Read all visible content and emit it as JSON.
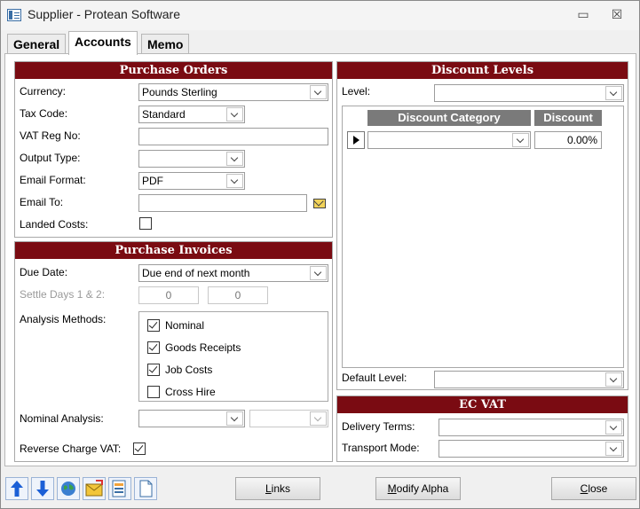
{
  "window": {
    "title": "Supplier - Protean Software",
    "minimize": "▭",
    "close": "☒"
  },
  "tabs": [
    {
      "label": "General",
      "active": false
    },
    {
      "label": "Accounts",
      "active": true
    },
    {
      "label": "Memo",
      "active": false
    }
  ],
  "purchase_orders": {
    "header": "Purchase Orders",
    "currency_label": "Currency:",
    "currency_value": "Pounds Sterling",
    "tax_code_label": "Tax Code:",
    "tax_code_value": "Standard",
    "vat_reg_label": "VAT Reg No:",
    "vat_reg_value": "",
    "output_type_label": "Output Type:",
    "output_type_value": "",
    "email_format_label": "Email Format:",
    "email_format_value": "PDF",
    "email_to_label": "Email To:",
    "email_to_value": "",
    "landed_costs_label": "Landed Costs:",
    "landed_costs_checked": false
  },
  "purchase_invoices": {
    "header": "Purchase Invoices",
    "due_date_label": "Due Date:",
    "due_date_value": "Due end of next month",
    "settle_days_label": "Settle Days 1 & 2:",
    "settle_day_1": "0",
    "settle_day_2": "0",
    "analysis_methods_label": "Analysis Methods:",
    "analysis_methods": [
      {
        "label": "Nominal",
        "checked": true
      },
      {
        "label": "Goods Receipts",
        "checked": true
      },
      {
        "label": "Job Costs",
        "checked": true
      },
      {
        "label": "Cross Hire",
        "checked": false
      }
    ],
    "nominal_analysis_label": "Nominal Analysis:",
    "nominal_analysis_value_1": "",
    "nominal_analysis_value_2": "",
    "reverse_charge_label": "Reverse Charge VAT:",
    "reverse_charge_checked": true
  },
  "discount_levels": {
    "header": "Discount Levels",
    "level_label": "Level:",
    "level_value": "",
    "columns": [
      "Discount Category",
      "Discount"
    ],
    "rows": [
      {
        "category": "",
        "discount": "0.00%"
      }
    ],
    "default_level_label": "Default Level:",
    "default_level_value": ""
  },
  "ec_vat": {
    "header": "EC VAT",
    "delivery_terms_label": "Delivery Terms:",
    "delivery_terms_value": "",
    "transport_mode_label": "Transport Mode:",
    "transport_mode_value": ""
  },
  "toolbar": {
    "icons": [
      "arrow-up-icon",
      "arrow-down-icon",
      "globe-icon",
      "email-icon",
      "document-list-icon",
      "blank-document-icon"
    ],
    "links_prefix": "L",
    "links_rest": "inks",
    "modify_prefix": "M",
    "modify_rest": "odify Alpha",
    "close_prefix": "C",
    "close_rest": "lose"
  },
  "colors": {
    "panel_header": "#7a0b12",
    "grid_header": "#7a7a7a",
    "arrow_blue": "#1b5fd6"
  }
}
